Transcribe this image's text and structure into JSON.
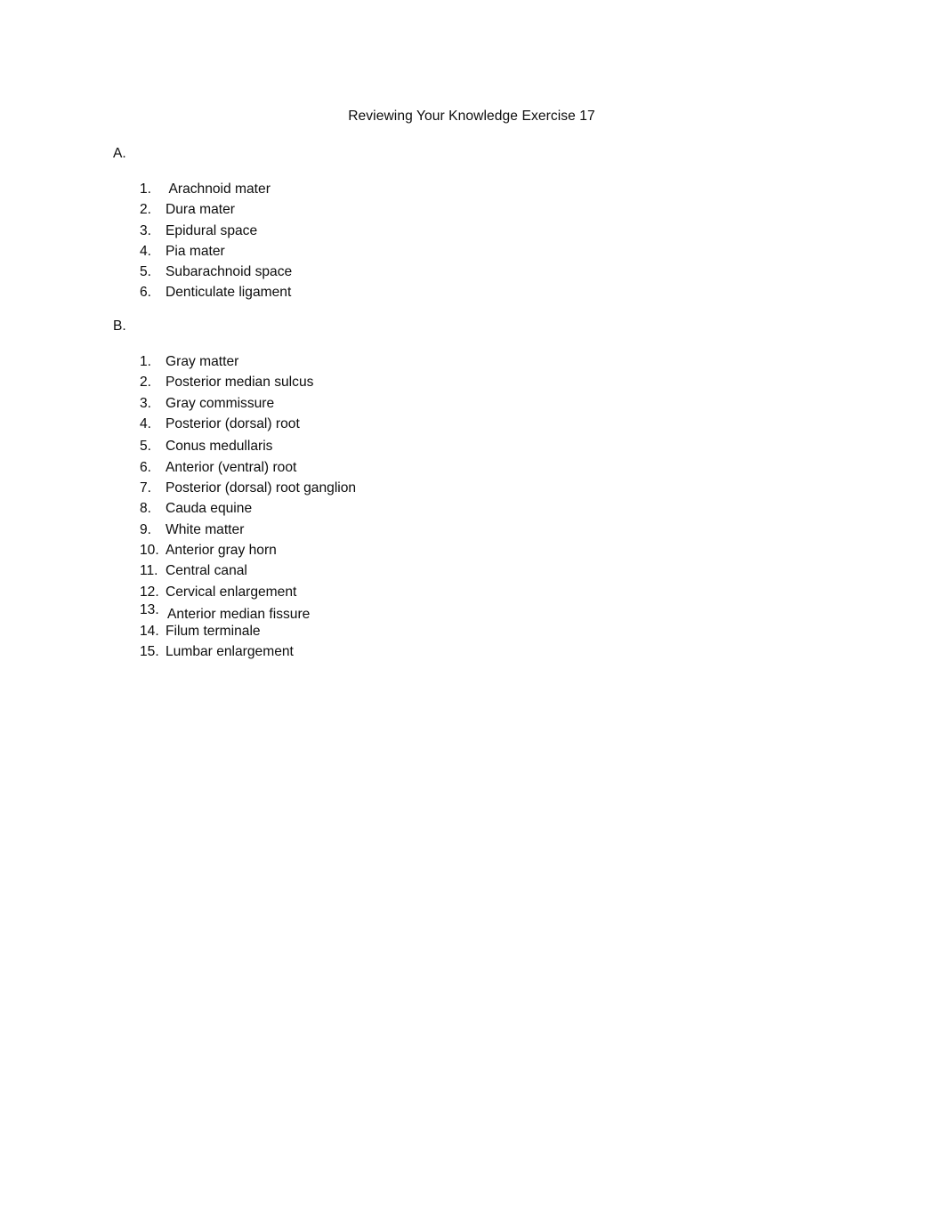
{
  "document": {
    "title": "Reviewing Your Knowledge Exercise 17",
    "text_color": "#0d0d0d",
    "background_color": "#ffffff"
  },
  "sections": [
    {
      "letter": "A.",
      "items": [
        {
          "number": "1.",
          "label": " Arachnoid mater"
        },
        {
          "number": "2.",
          "label": "Dura mater"
        },
        {
          "number": "3.",
          "label": "Epidural space"
        },
        {
          "number": "4.",
          "label": "Pia mater"
        },
        {
          "number": "5.",
          "label": "Subarachnoid space"
        },
        {
          "number": "6.",
          "label": "Denticulate ligament"
        }
      ]
    },
    {
      "letter": "B.",
      "items": [
        {
          "number": "1.",
          "label": "Gray matter"
        },
        {
          "number": "2.",
          "label": "Posterior median sulcus"
        },
        {
          "number": "3.",
          "label": "Gray commissure"
        },
        {
          "number": "4.",
          "label": "Posterior (dorsal) root"
        },
        {
          "number": "5.",
          "label": "Conus medullaris"
        },
        {
          "number": "6.",
          "label": "Anterior (ventral) root"
        },
        {
          "number": "7.",
          "label": "Posterior (dorsal) root ganglion"
        },
        {
          "number": "8.",
          "label": "Cauda equine"
        },
        {
          "number": "9.",
          "label": "White matter"
        },
        {
          "number": "10.",
          "label": "Anterior gray horn"
        },
        {
          "number": "11.",
          "label": "Central canal"
        },
        {
          "number": "12.",
          "label": "Cervical enlargement"
        },
        {
          "number": "13.",
          "label": "Anterior median fissure"
        },
        {
          "number": "14.",
          "label": "Filum terminale"
        },
        {
          "number": "15.",
          "label": "Lumbar enlargement"
        }
      ]
    }
  ]
}
